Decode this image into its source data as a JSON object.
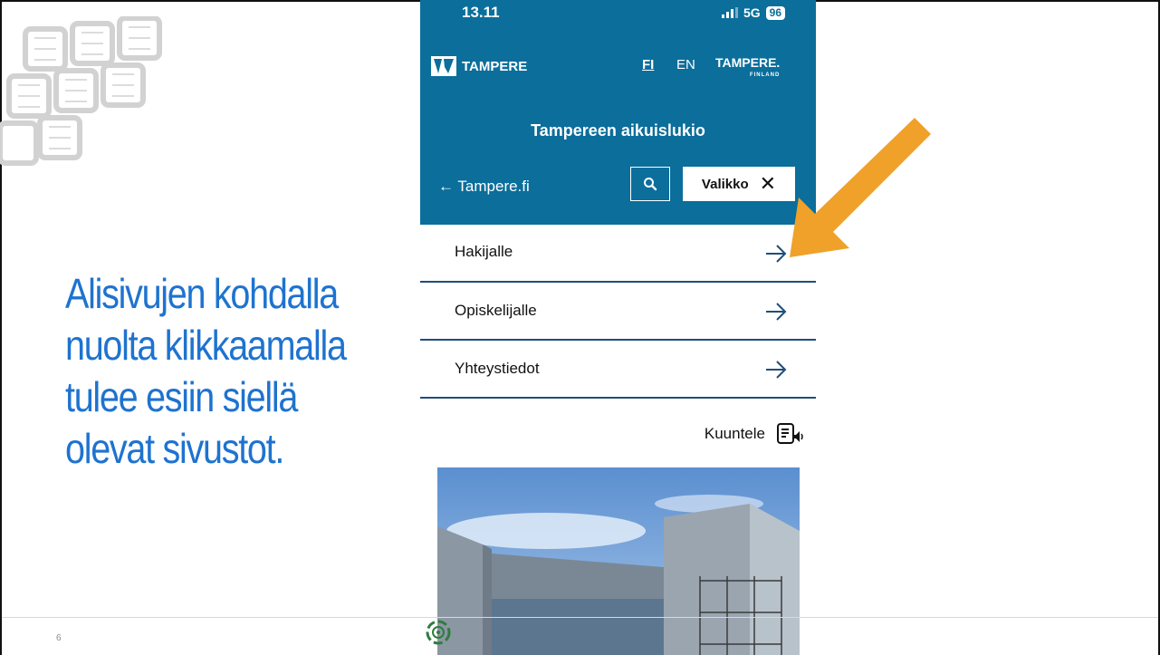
{
  "slide": {
    "caption_lines": [
      "Alisivujen kohdalla",
      "nuolta klikkaamalla",
      "tulee esiin siellä",
      "olevat sivustot."
    ],
    "page_number": "6"
  },
  "phone": {
    "status": {
      "time": "13.11",
      "network": "5G",
      "battery": "96"
    },
    "topbar": {
      "logo_text": "TAMPERE",
      "lang_fi": "FI",
      "lang_en": "EN",
      "brand_main": "TAMPERE.",
      "brand_sub": "FINLAND"
    },
    "header": {
      "title": "Tampereen aikuislukio",
      "back_link": "← Tampere.fi",
      "menu_label": "Valikko",
      "menu_close": "✕"
    },
    "menu_items": [
      {
        "label": "Hakijalle"
      },
      {
        "label": "Opiskelijalle"
      },
      {
        "label": "Yhteystiedot"
      }
    ],
    "listen_label": "Kuuntele"
  },
  "colors": {
    "header_bg": "#0b6e9b",
    "caption": "#1e73cf",
    "annotation_arrow": "#f0a12a",
    "divider": "#1f4e79"
  },
  "icons": [
    "search-icon",
    "close-icon",
    "arrow-right-icon",
    "listen-icon",
    "accessibility-icon",
    "tampere-logo"
  ]
}
